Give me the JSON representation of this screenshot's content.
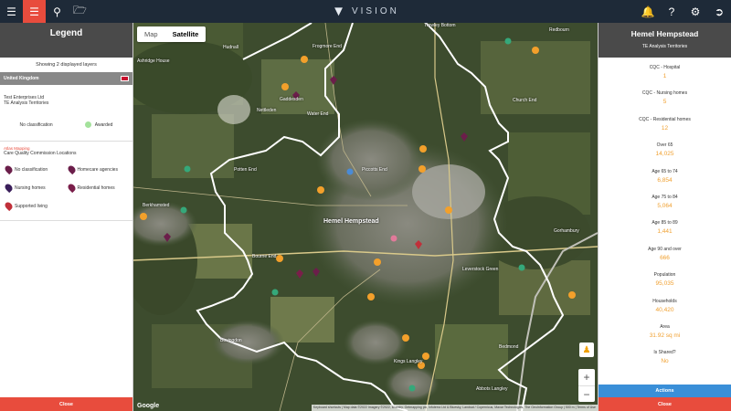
{
  "topbar": {
    "brand": "VISION",
    "left_icons": [
      "menu-icon",
      "list-icon",
      "search-icon",
      "folder-icon"
    ],
    "right_icons": [
      "bell-icon",
      "help-icon",
      "gear-icon",
      "logout-icon"
    ]
  },
  "legend": {
    "title": "Legend",
    "subtitle": "Showing 2 displayed layers",
    "region": "United Kingdom",
    "org": "Test Enterprises Ltd",
    "layer1": "TE Analysis Territories",
    "no_class": "No classification",
    "awarded": "Awarded",
    "layer2_tag": "Atlas Mapping",
    "layer2": "Care Quality Commission Locations",
    "items": [
      {
        "label": "No classification",
        "color": "#6b1e4a"
      },
      {
        "label": "Homecare agencies",
        "color": "#6b1e4a"
      },
      {
        "label": "Nursing homes",
        "color": "#3a1e5a"
      },
      {
        "label": "Residential homes",
        "color": "#7a1e4a"
      },
      {
        "label": "Supported living",
        "color": "#c0303a"
      }
    ],
    "close": "Close"
  },
  "map": {
    "type_map": "Map",
    "type_satellite": "Satellite",
    "labels": {
      "hemel": "Hemel Hempstead",
      "berkhamsted": "Berkhamsted",
      "potten_end": "Potten End",
      "bourne_end": "Bourne End",
      "bovingdon": "Bovingdon",
      "kings_langley": "Kings Langley",
      "abbots_langley": "Abbots Langley",
      "bedmond": "Bedmond",
      "water_end": "Water End",
      "nettleden": "Nettleden",
      "gaddesden": "Gaddesden",
      "ashridge": "Ashridge House",
      "hudnall": "Hudnall",
      "leverstock": "Leverstock Green",
      "gorhambury": "Gorhambury",
      "frogmore": "Frogmore End",
      "church_end": "Church End",
      "redbourn": "Redbourn",
      "trowley": "Trowley Bottom",
      "piccotts": "Piccotts End"
    },
    "google": "Google",
    "attribution": "Keyboard shortcuts | Map data ©2022 Imagery ©2022, Bluesky, Getmapping plc, Infoterra Ltd & Bluesky, Landsat / Copernicus, Maxar Technologies, The GeoInformation Group | 500 m | Terms of Use"
  },
  "detail": {
    "title": "Hemel Hempstead",
    "subtitle": "TE Analysis Territories",
    "stats": [
      {
        "label": "CQC - Hospital",
        "value": "1"
      },
      {
        "label": "CQC - Nursing homes",
        "value": "5"
      },
      {
        "label": "CQC - Residential homes",
        "value": "12"
      },
      {
        "label": "Over 65",
        "value": "14,025"
      },
      {
        "label": "Age 65 to 74",
        "value": "6,854"
      },
      {
        "label": "Age 75 to 84",
        "value": "5,064"
      },
      {
        "label": "Age 85 to 89",
        "value": "1,441"
      },
      {
        "label": "Age 90 and over",
        "value": "666"
      },
      {
        "label": "Population",
        "value": "95,035"
      },
      {
        "label": "Households",
        "value": "40,420"
      },
      {
        "label": "Area",
        "value": "31.92 sq mi"
      },
      {
        "label": "Is Shared?",
        "value": "No"
      }
    ],
    "actions": "Actions",
    "close": "Close"
  }
}
